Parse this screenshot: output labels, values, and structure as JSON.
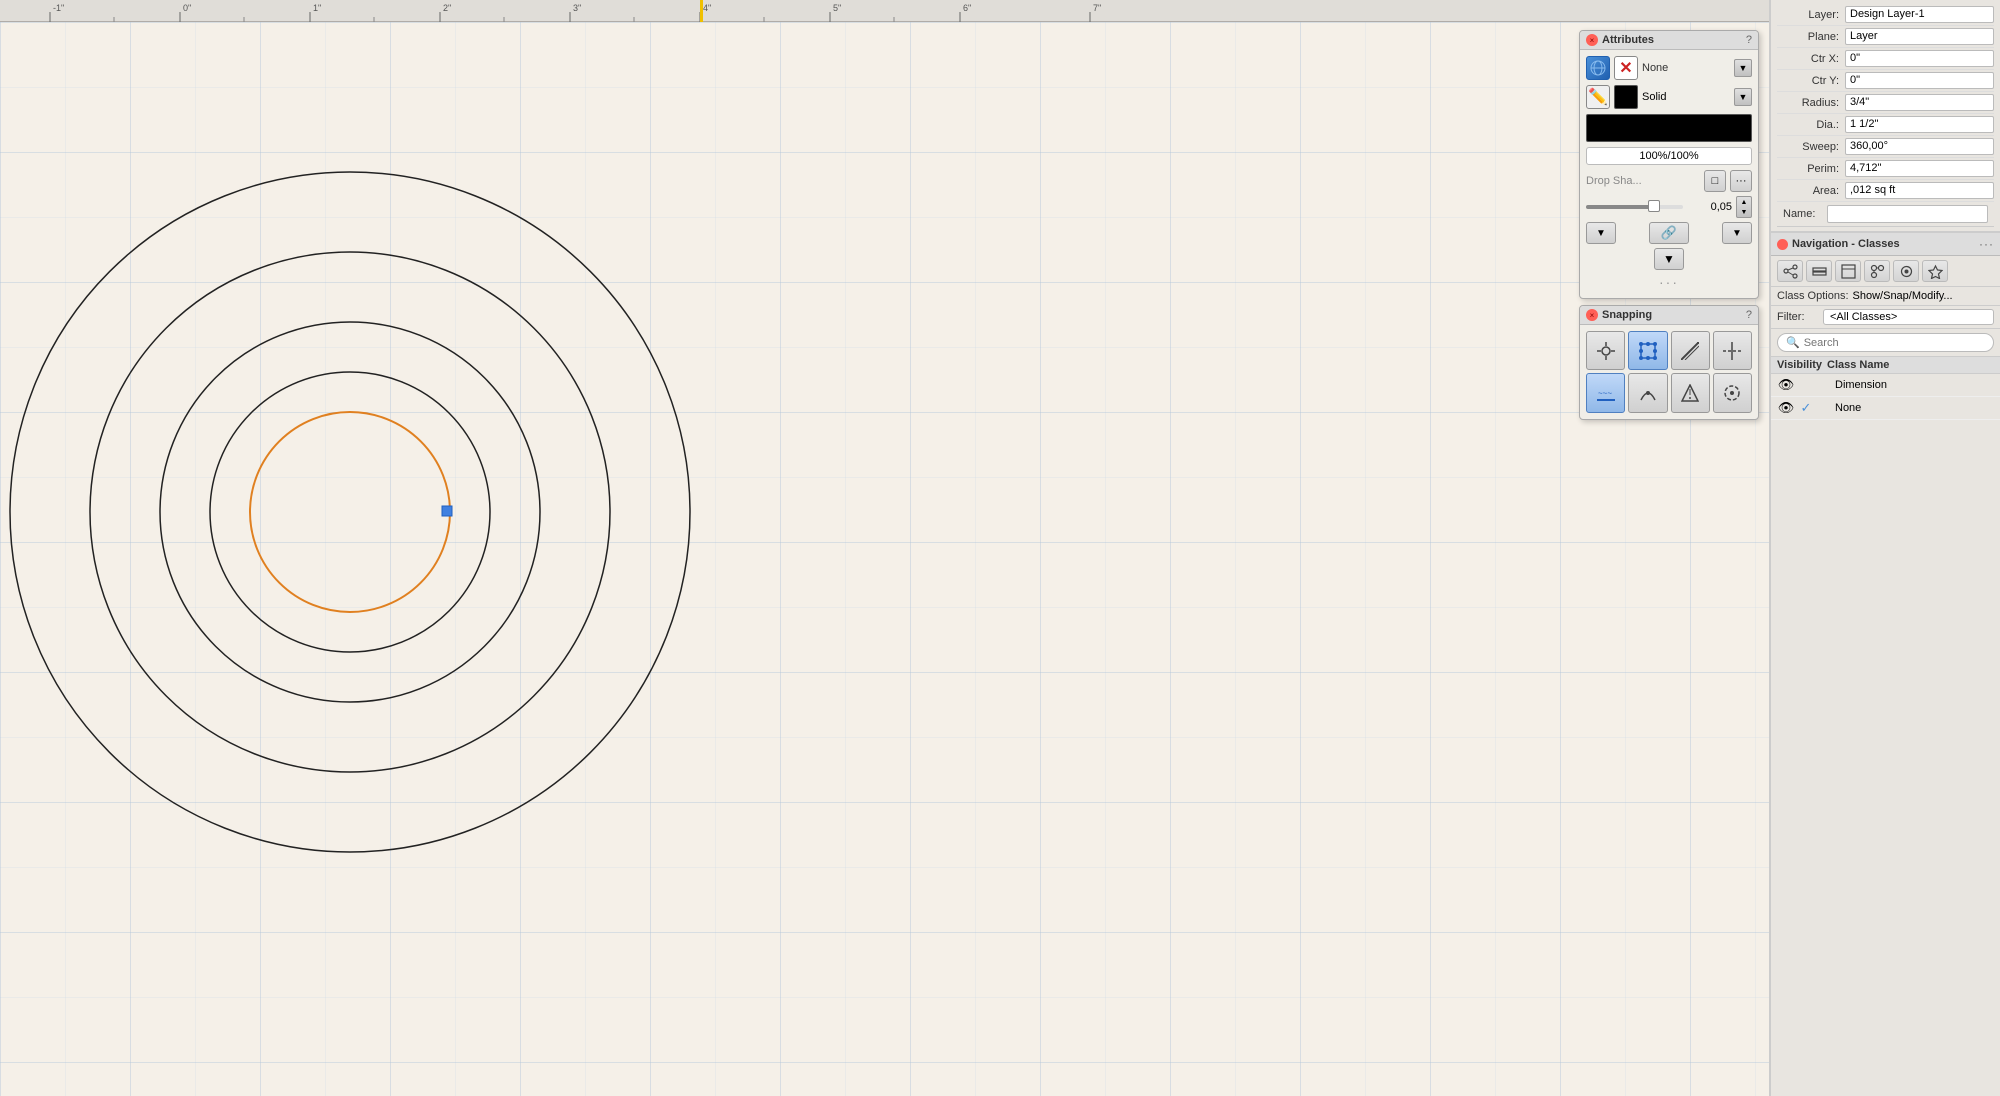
{
  "ruler": {
    "marks": [
      "-1\"",
      "0\"",
      "1\"",
      "2\"",
      "3\"",
      "4\"",
      "5\"",
      "6\"",
      "7\""
    ]
  },
  "attributes_panel": {
    "title": "Attributes",
    "fill_label": "None",
    "stroke_type": "Solid",
    "opacity": "100%/100%",
    "drop_shadow_label": "Drop Sha...",
    "slider_value": "0,05"
  },
  "snapping_panel": {
    "title": "Snapping"
  },
  "right_props": {
    "layer_label": "Layer:",
    "layer_value": "Design Layer-1",
    "plane_label": "Plane:",
    "plane_value": "Layer",
    "ctr_x_label": "Ctr X:",
    "ctr_x_value": "0\"",
    "ctr_y_label": "Ctr Y:",
    "ctr_y_value": "0\"",
    "radius_label": "Radius:",
    "radius_value": "3/4\"",
    "dia_label": "Dia.:",
    "dia_value": "1 1/2\"",
    "sweep_label": "Sweep:",
    "sweep_value": "360,00°",
    "perim_label": "Perim:",
    "perim_value": "4,712\"",
    "area_label": "Area:",
    "area_value": ",012 sq ft",
    "name_label": "Name:",
    "name_value": ""
  },
  "nav_classes": {
    "title": "Navigation - Classes",
    "class_options_label": "Class Options:",
    "class_options_value": "Show/Snap/Modify...",
    "filter_label": "Filter:",
    "filter_value": "<All Classes>",
    "search_placeholder": "Search",
    "col_visibility": "Visibility",
    "col_class_name": "Class Name",
    "classes": [
      {
        "name": "Dimension",
        "visible": true,
        "editable": false
      },
      {
        "name": "None",
        "visible": true,
        "editable": true
      }
    ]
  }
}
